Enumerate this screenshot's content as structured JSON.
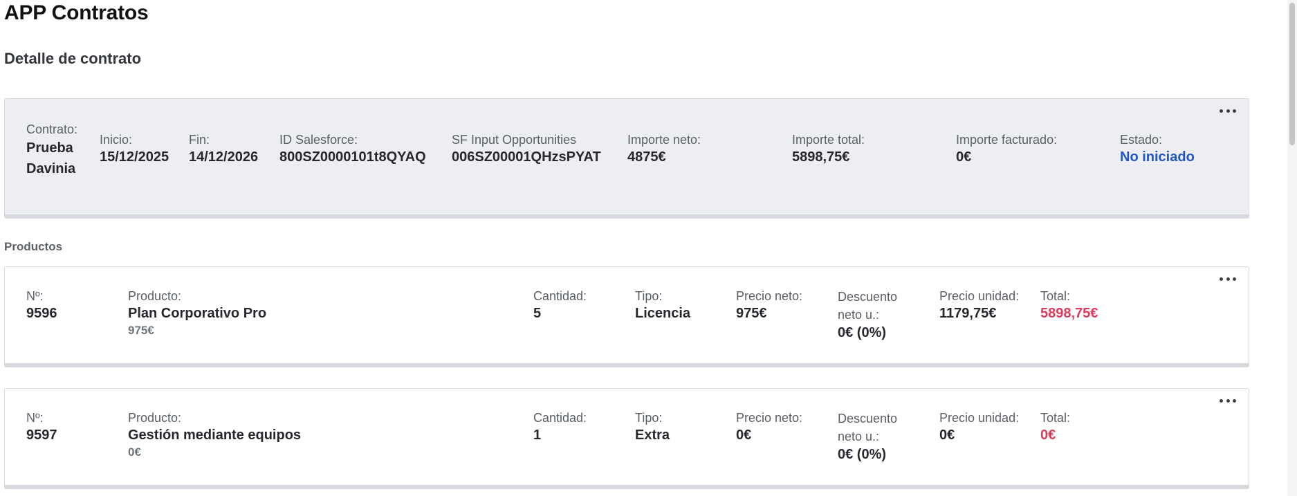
{
  "app": {
    "title": "APP Contratos",
    "subtitle": "Detalle de contrato"
  },
  "summary": {
    "contrato": {
      "label": "Contrato:",
      "value": "Prueba Davinia"
    },
    "inicio": {
      "label": "Inicio:",
      "value": "15/12/2025"
    },
    "fin": {
      "label": "Fin:",
      "value": "14/12/2026"
    },
    "id_salesforce": {
      "label": "ID Salesforce:",
      "value": "800SZ0000101t8QYAQ"
    },
    "sf_input": {
      "label": "SF Input Opportunities",
      "value": "006SZ00001QHzsPYAT"
    },
    "importe_neto": {
      "label": "Importe neto:",
      "value": "4875€"
    },
    "importe_total": {
      "label": "Importe total:",
      "value": "5898,75€"
    },
    "importe_facturado": {
      "label": "Importe facturado:",
      "value": "0€"
    },
    "estado": {
      "label": "Estado:",
      "value": "No iniciado"
    }
  },
  "products_section": {
    "title": "Productos"
  },
  "labels": {
    "numero": "Nº:",
    "producto": "Producto:",
    "cantidad": "Cantidad:",
    "tipo": "Tipo:",
    "precio_neto": "Precio neto:",
    "descuento": "Descuento neto u.:",
    "precio_unidad": "Precio unidad:",
    "total": "Total:"
  },
  "products": [
    {
      "numero": "9596",
      "producto": "Plan Corporativo Pro",
      "producto_precio": "975€",
      "cantidad": "5",
      "tipo": "Licencia",
      "precio_neto": "975€",
      "descuento": "0€ (0%)",
      "precio_unidad": "1179,75€",
      "total": "5898,75€"
    },
    {
      "numero": "9597",
      "producto": "Gestión mediante equipos",
      "producto_precio": "0€",
      "cantidad": "1",
      "tipo": "Extra",
      "precio_neto": "0€",
      "descuento": "0€ (0%)",
      "precio_unidad": "0€",
      "total": "0€"
    }
  ],
  "colors": {
    "estado": "#2356c4",
    "total": "#e23a5a",
    "card_bg": "#edeef1"
  },
  "icons": {
    "more": "more-horizontal-icon"
  }
}
